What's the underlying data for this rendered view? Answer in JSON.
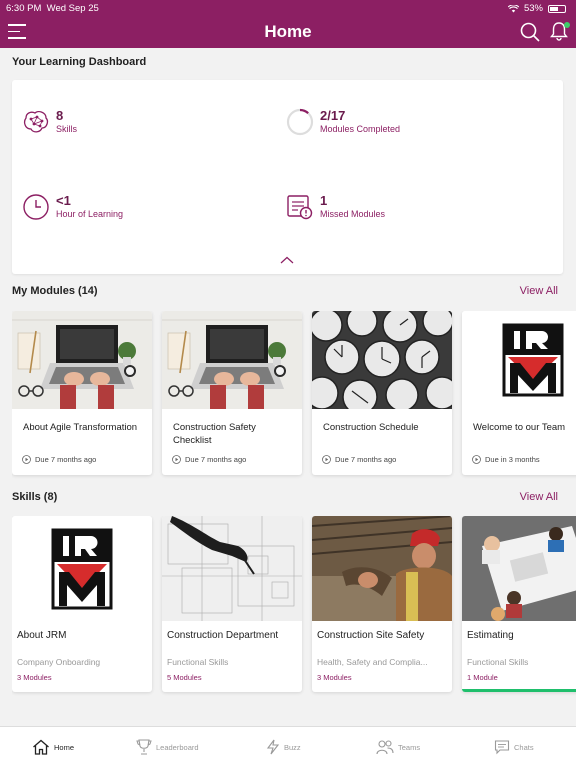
{
  "status_bar": {
    "time": "6:30 PM",
    "date": "Wed Sep 25",
    "battery": "53%"
  },
  "header": {
    "title": "Home"
  },
  "dashboard": {
    "title": "Your Learning Dashboard",
    "stats": [
      {
        "value": "8",
        "label": "Skills",
        "icon": "brain-icon"
      },
      {
        "value": "2/17",
        "label": "Modules Completed",
        "icon": "progress-ring-icon",
        "fraction": 0.118
      },
      {
        "value": "<1",
        "label": "Hour of Learning",
        "icon": "clock-icon"
      },
      {
        "value": "1",
        "label": "Missed Modules",
        "icon": "missed-doc-icon"
      }
    ]
  },
  "modules": {
    "title": "My Modules (14)",
    "view_all": "View All",
    "items": [
      {
        "title": "About Agile Transformation",
        "due": "Due 7 months ago",
        "image": "laptop-desk"
      },
      {
        "title": "Construction Safety Checklist",
        "due": "Due 7 months ago",
        "image": "laptop-desk"
      },
      {
        "title": "Construction Schedule",
        "due": "Due 7 months ago",
        "image": "clocks"
      },
      {
        "title": "Welcome to our Team",
        "due": "Due in 3 months",
        "image": "jrm-logo"
      }
    ]
  },
  "skills": {
    "title": "Skills (8)",
    "view_all": "View All",
    "items": [
      {
        "title": "About JRM",
        "category": "Company Onboarding",
        "count": "3 Modules",
        "image": "jrm-logo"
      },
      {
        "title": "Construction Department",
        "category": "Functional Skills",
        "count": "5 Modules",
        "image": "blueprint"
      },
      {
        "title": "Construction Site Safety",
        "category": "Health, Safety and Complia...",
        "count": "3 Modules",
        "image": "worker"
      },
      {
        "title": "Estimating",
        "category": "Functional Skills",
        "count": "1 Module",
        "image": "meeting",
        "progress": 1.0
      }
    ]
  },
  "tabbar": {
    "tabs": [
      {
        "label": "Home",
        "icon": "home-icon",
        "active": true
      },
      {
        "label": "Leaderboard",
        "icon": "trophy-icon",
        "active": false
      },
      {
        "label": "Buzz",
        "icon": "lightning-icon",
        "active": false
      },
      {
        "label": "Teams",
        "icon": "people-icon",
        "active": false
      },
      {
        "label": "Chats",
        "icon": "chat-icon",
        "active": false
      }
    ]
  },
  "colors": {
    "brand": "#8c1f63",
    "accent_green": "#1fbf6c",
    "background": "#f2f2f2"
  }
}
